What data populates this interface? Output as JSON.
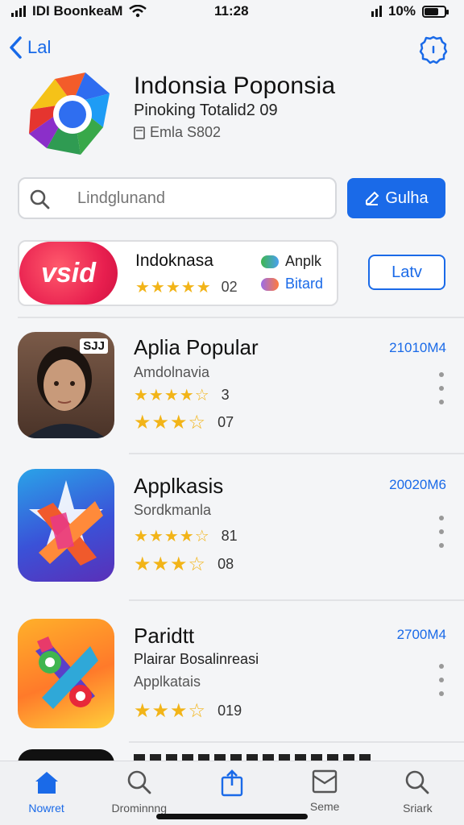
{
  "status_bar": {
    "carrier": "IDI BoonkeaM",
    "time": "11:28",
    "battery": "10%"
  },
  "nav": {
    "back_label": "Lal"
  },
  "app": {
    "title": "Indonsia Poponsia",
    "subtitle": "Pinoking Totalid2 09",
    "meta": "Emla S802"
  },
  "search": {
    "placeholder": "Lindglunand",
    "button_label": "Gulha"
  },
  "featured": {
    "banner_text": "vsid",
    "name": "Indoknasa",
    "rating_value": "02",
    "tag_one": "Anplk",
    "tag_two": "Bitard",
    "button_label": "Latv"
  },
  "list": {
    "items": [
      {
        "name": "Aplia Popular",
        "sub": "Amdolnavia",
        "rating_a": "3",
        "rating_b": "07",
        "size": "21010M4",
        "badge": "SJJ"
      },
      {
        "name": "Applkasis",
        "sub": "Sordkmanla",
        "rating_a": "81",
        "rating_b": "08",
        "size": "20020M6"
      },
      {
        "name": "Paridtt",
        "sub": "Plairar Bosalinreasi",
        "sub2": "Applkatais",
        "rating_a": "019",
        "size": "2700M4"
      }
    ]
  },
  "tabs": [
    {
      "label": "Nowret",
      "icon": "home-icon"
    },
    {
      "label": "Drominnng",
      "icon": "search-icon"
    },
    {
      "label": "",
      "icon": "share-icon"
    },
    {
      "label": "Seme",
      "icon": "inbox-icon"
    },
    {
      "label": "Sriark",
      "icon": "search-icon"
    }
  ],
  "colors": {
    "accent": "#1a6ae8",
    "star": "#f2b418"
  }
}
